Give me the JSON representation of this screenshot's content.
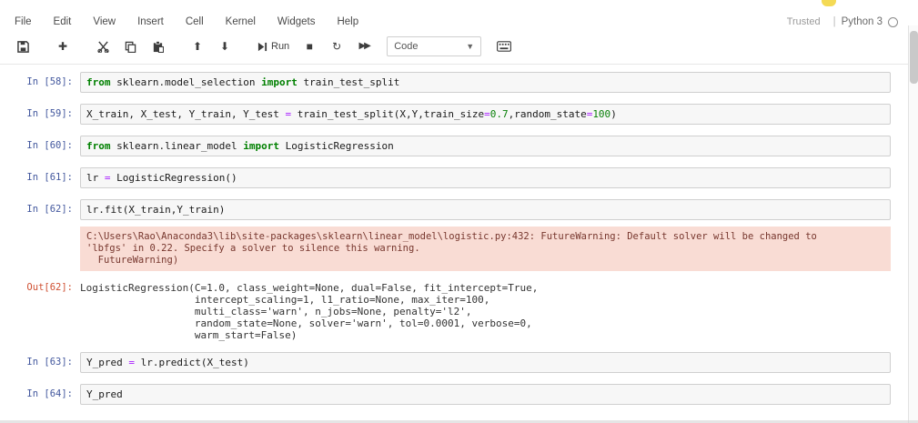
{
  "header": {
    "menu": [
      "File",
      "Edit",
      "View",
      "Insert",
      "Cell",
      "Kernel",
      "Widgets",
      "Help"
    ],
    "trusted_label": "Trusted",
    "kernel_separator": "|",
    "kernel_name": "Python 3"
  },
  "toolbar": {
    "run_label": "Run",
    "cell_type_value": "Code",
    "icons": [
      "save-icon",
      "add-cell-icon",
      "cut-icon",
      "copy-icon",
      "paste-icon",
      "move-up-icon",
      "move-down-icon",
      "run-icon",
      "stop-icon",
      "restart-icon",
      "fast-forward-icon",
      "command-palette-icon"
    ]
  },
  "colors": {
    "in_prompt": "#43589e",
    "out_prompt": "#cf5032",
    "keyword": "#008000",
    "number": "#088008",
    "operator": "#aa22ff",
    "stderr_bg": "#f9dcd4",
    "input_bg": "#f7f7f7",
    "notification_dot": "#f2d437"
  },
  "notebook": {
    "cells": [
      {
        "prompt": "In [58]:",
        "tokens": [
          [
            "kw",
            "from"
          ],
          [
            "pl",
            " sklearn.model_selection "
          ],
          [
            "kw",
            "import"
          ],
          [
            "pl",
            " train_test_split"
          ]
        ]
      },
      {
        "prompt": "In [59]:",
        "tokens": [
          [
            "pl",
            "X_train, X_test, Y_train, Y_test "
          ],
          [
            "op",
            "="
          ],
          [
            "pl",
            " train_test_split(X,Y,train_size"
          ],
          [
            "op",
            "="
          ],
          [
            "num",
            "0.7"
          ],
          [
            "pl",
            ",random_state"
          ],
          [
            "op",
            "="
          ],
          [
            "num",
            "100"
          ],
          [
            "pl",
            ")"
          ]
        ]
      },
      {
        "prompt": "In [60]:",
        "tokens": [
          [
            "kw",
            "from"
          ],
          [
            "pl",
            " sklearn.linear_model "
          ],
          [
            "kw",
            "import"
          ],
          [
            "pl",
            " LogisticRegression"
          ]
        ]
      },
      {
        "prompt": "In [61]:",
        "tokens": [
          [
            "pl",
            "lr "
          ],
          [
            "op",
            "="
          ],
          [
            "pl",
            " LogisticRegression()"
          ]
        ]
      },
      {
        "prompt": "In [62]:",
        "tokens": [
          [
            "pl",
            "lr.fit(X_train,Y_train)"
          ]
        ],
        "stderr": [
          "C:\\Users\\Rao\\Anaconda3\\lib\\site-packages\\sklearn\\linear_model\\logistic.py:432: FutureWarning: Default solver will be changed to",
          "'lbfgs' in 0.22. Specify a solver to silence this warning.",
          "  FutureWarning)"
        ],
        "out_prompt": "Out[62]:",
        "out_lines": [
          "LogisticRegression(C=1.0, class_weight=None, dual=False, fit_intercept=True,",
          "                   intercept_scaling=1, l1_ratio=None, max_iter=100,",
          "                   multi_class='warn', n_jobs=None, penalty='l2',",
          "                   random_state=None, solver='warn', tol=0.0001, verbose=0,",
          "                   warm_start=False)"
        ]
      },
      {
        "prompt": "In [63]:",
        "tokens": [
          [
            "pl",
            "Y_pred "
          ],
          [
            "op",
            "="
          ],
          [
            "pl",
            " lr.predict(X_test)"
          ]
        ]
      },
      {
        "prompt": "In [64]:",
        "tokens": [
          [
            "pl",
            "Y_pred"
          ]
        ]
      }
    ]
  }
}
